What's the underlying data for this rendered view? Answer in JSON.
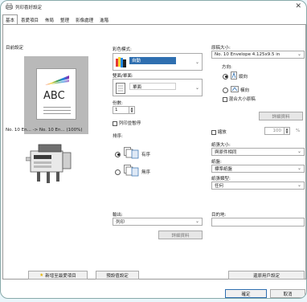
{
  "window": {
    "title": "列印喜好設定",
    "close_glyph": "✕"
  },
  "tabs": [
    {
      "label": "基本",
      "active": true
    },
    {
      "label": "喜愛項目"
    },
    {
      "label": "佈局"
    },
    {
      "label": "整理"
    },
    {
      "label": "影像處理"
    },
    {
      "label": "進階"
    }
  ],
  "current_settings": {
    "heading": "目前設定",
    "preview_text": "ABC",
    "caption": "No. 10 En... -> No. 10 En... (100%)"
  },
  "color_mode": {
    "label": "彩色模式:",
    "value": "自動"
  },
  "duplex": {
    "label": "雙面/單面:",
    "value": "單面"
  },
  "copies": {
    "label": "份數:",
    "value": "1",
    "hold_label": "列印並暫停"
  },
  "collate": {
    "label": "排序:",
    "options": [
      "有序",
      "無序"
    ],
    "selected": 0
  },
  "original_size": {
    "label": "原稿大小:",
    "value": "No. 10 Envelope 4.125x9.5 in",
    "orientation_label": "方向:",
    "orientations": [
      "縱向",
      "橫向"
    ],
    "orientation_selected": 0,
    "mixed_label": "混合大小原稿",
    "detail_button": "詳細資料"
  },
  "zoom": {
    "label": "縮放",
    "value": "100",
    "unit": "%"
  },
  "paper_size": {
    "label": "紙張大小:",
    "value": "與原件相同"
  },
  "paper_tray": {
    "label": "紙盤:",
    "value": "標準紙盤"
  },
  "paper_type": {
    "label": "紙張類型:",
    "value": "任何"
  },
  "output": {
    "label": "輸出:",
    "value": "列印",
    "detail_button": "詳細資料"
  },
  "destination": {
    "label": "目的地:",
    "value": ""
  },
  "footer": {
    "add_favorite": "新增至最愛項目",
    "default": "預設值設定",
    "restore": "還原用戶設定",
    "ok": "確定",
    "cancel": "取消"
  },
  "colors": {
    "accent": "#2f6fb0",
    "frame": "#eaf6fb"
  }
}
